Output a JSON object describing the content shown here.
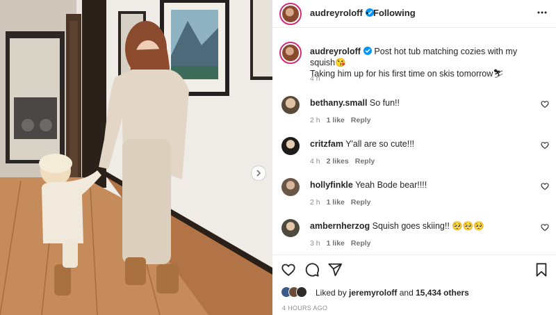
{
  "post": {
    "username": "audreyroloff",
    "follow_status": "Following",
    "separator": "•",
    "caption_line1": "Post hot tub matching cozies with my squish😘",
    "caption_line2": "Taking him up for his first time on skis tomorrow⛷",
    "caption_time": "4 h"
  },
  "comments": [
    {
      "user": "bethany.small",
      "text": "So fun!!",
      "time": "2 h",
      "likes": "1 like",
      "reply": "Reply"
    },
    {
      "user": "critzfam",
      "text": "Y'all are so cute!!!",
      "time": "4 h",
      "likes": "2 likes",
      "reply": "Reply"
    },
    {
      "user": "hollyfinkle",
      "text": "Yeah Bode bear!!!!",
      "time": "2 h",
      "likes": "1 like",
      "reply": "Reply"
    },
    {
      "user": "ambernherzog",
      "text": "Squish goes skiing!! 🥺🥺🥺",
      "time": "3 h",
      "likes": "1 like",
      "reply": "Reply"
    }
  ],
  "likes": {
    "prefix": "Liked by",
    "user": "jeremyroloff",
    "conjunction": "and",
    "others": "15,434 others"
  },
  "post_time": "4 HOURS AGO",
  "icons": {
    "more": "more-horizontal-icon",
    "verified": "verified-badge-icon",
    "heart": "heart-outline-icon",
    "comment": "comment-bubble-icon",
    "share": "paper-plane-icon",
    "save": "bookmark-icon",
    "next": "chevron-right-icon"
  },
  "colors": {
    "verified_blue": "#0095f6",
    "story_ring": "#d62976",
    "meta_gray": "#8e8e8e",
    "text": "#262626"
  }
}
